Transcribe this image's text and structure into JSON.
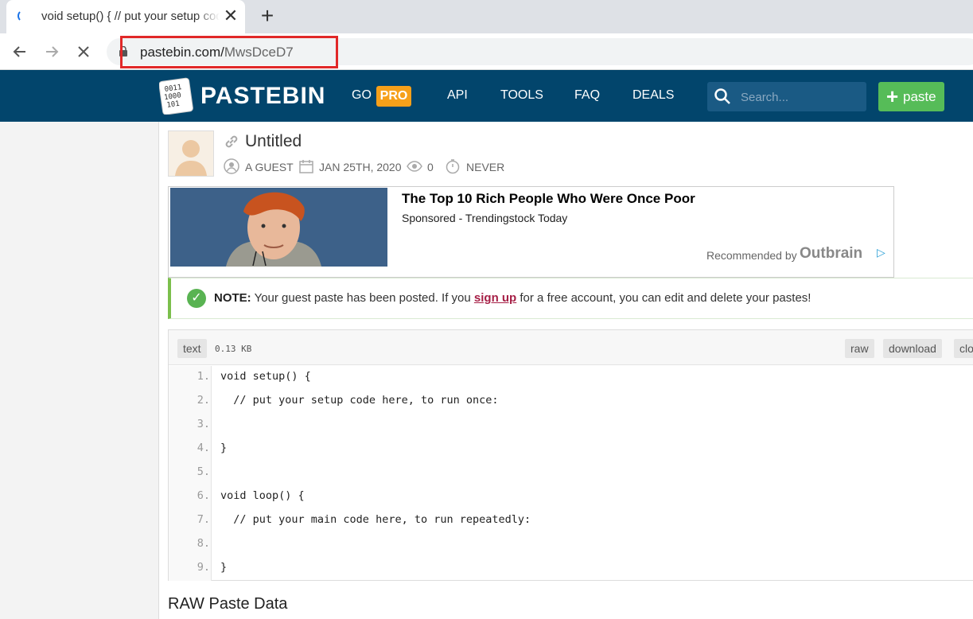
{
  "browser": {
    "tab_title": "void setup() { // put your setup code here",
    "tab_close": "✕",
    "new_tab": "+",
    "url_domain": "pastebin.com/",
    "url_path": "MwsDceD7"
  },
  "header": {
    "logo_text": "PASTEBIN",
    "nav_go": "GO",
    "nav_pro": "PRO",
    "nav_api": "API",
    "nav_tools": "TOOLS",
    "nav_faq": "FAQ",
    "nav_deals": "DEALS",
    "search_placeholder": "Search...",
    "paste_plus": "+",
    "paste_button": "paste"
  },
  "paste": {
    "title": "Untitled",
    "author": "A GUEST",
    "date": "JAN 25TH, 2020",
    "views": "0",
    "expiration": "NEVER"
  },
  "ad": {
    "title": "The Top 10 Rich People Who Were Once Poor",
    "subtitle": "Sponsored - Trendingstock Today",
    "recommended": "Recommended by",
    "brand": "Outbrain",
    "choice_icon": "▷"
  },
  "note": {
    "label": "NOTE:",
    "text_before": " Your guest paste has been posted. If you ",
    "signup": "sign up",
    "text_after": " for a free account, you can edit and delete your pastes!"
  },
  "code": {
    "syntax": "text",
    "size": "0.13 KB",
    "raw": "raw",
    "download": "download",
    "clone": "clone",
    "lines": [
      {
        "num": "1.",
        "text": "void setup() {"
      },
      {
        "num": "2.",
        "text": "  // put your setup code here, to run once:"
      },
      {
        "num": "3.",
        "text": ""
      },
      {
        "num": "4.",
        "text": "}"
      },
      {
        "num": "5.",
        "text": ""
      },
      {
        "num": "6.",
        "text": "void loop() {"
      },
      {
        "num": "7.",
        "text": "  // put your main code here, to run repeatedly:"
      },
      {
        "num": "8.",
        "text": ""
      },
      {
        "num": "9.",
        "text": "}"
      }
    ]
  },
  "raw_section_title": "RAW Paste Data"
}
